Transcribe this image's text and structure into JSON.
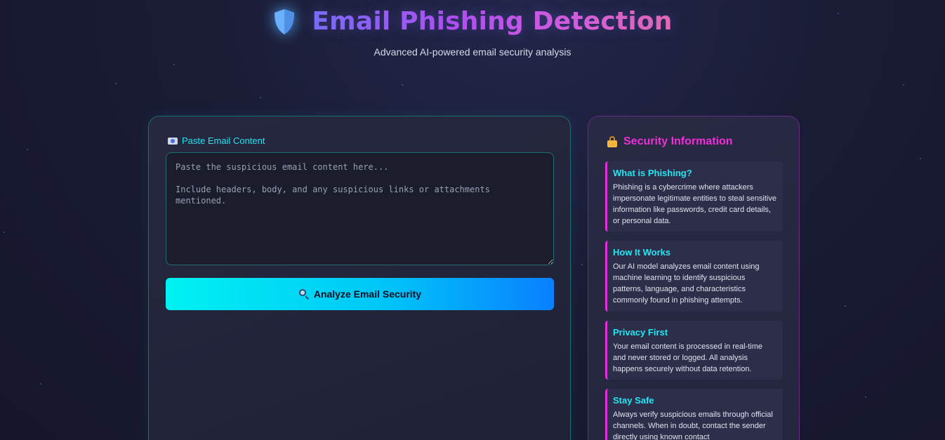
{
  "header": {
    "title": "Email Phishing Detection",
    "subtitle": "Advanced AI-powered email security analysis"
  },
  "analyzer": {
    "label": "Paste Email Content",
    "placeholder": "Paste the suspicious email content here...\n\nInclude headers, body, and any suspicious links or attachments mentioned.",
    "button_label": "Analyze Email Security"
  },
  "info": {
    "title": "Security Information",
    "items": [
      {
        "heading": "What is Phishing?",
        "text": "Phishing is a cybercrime where attackers impersonate legitimate entities to steal sensitive information like passwords, credit card details, or personal data."
      },
      {
        "heading": "How It Works",
        "text": "Our AI model analyzes email content using machine learning to identify suspicious patterns, language, and characteristics commonly found in phishing attempts."
      },
      {
        "heading": "Privacy First",
        "text": "Your email content is processed in real-time and never stored or logged. All analysis happens securely without data retention."
      },
      {
        "heading": "Stay Safe",
        "text": "Always verify suspicious emails through official channels. When in doubt, contact the sender directly using known contact"
      }
    ]
  },
  "colors": {
    "accent_cyan": "#22e4f2",
    "accent_magenta": "#f02fd6",
    "background": "#1a1c35"
  },
  "icons": {
    "title": "shield-icon",
    "label": "email-id-icon",
    "button": "magnifier-icon",
    "info": "lock-icon"
  }
}
